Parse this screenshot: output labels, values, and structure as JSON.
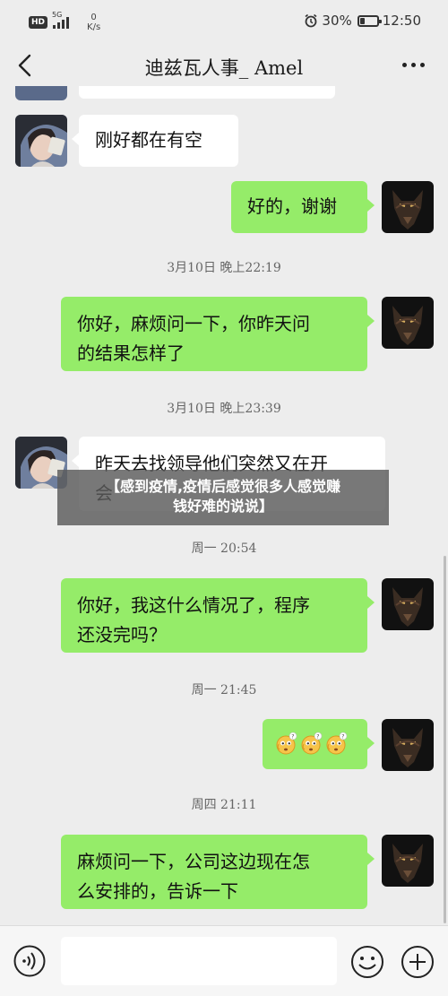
{
  "status_bar": {
    "hd_badge": "HD",
    "signal_label": "5G",
    "speed_value": "0",
    "speed_unit": "K/s",
    "battery": "30%",
    "battery_level": 0.3,
    "time": "12:50"
  },
  "header": {
    "title": "迪兹瓦人事_ Amel",
    "back_icon": "chevron-left-icon",
    "more_icon": "more-dots-icon"
  },
  "messages": [
    {
      "type": "in",
      "text": "刚好都在有空"
    },
    {
      "type": "out",
      "text": "好的，谢谢"
    },
    {
      "type": "time",
      "text": "3月10日  晚上22:19"
    },
    {
      "type": "out",
      "text_line1": "你好，麻烦问一下，你昨天问",
      "text_line2": "的结果怎样了"
    },
    {
      "type": "time",
      "text": "3月10日  晚上23:39"
    },
    {
      "type": "in",
      "text_line1": "昨天去找领导他们突然又在开",
      "text_line2": "会"
    },
    {
      "type": "time",
      "text": "周一  20:54"
    },
    {
      "type": "out",
      "text_line1": "你好，我这什么情况了，程序",
      "text_line2": "还没完吗？"
    },
    {
      "type": "time",
      "text": "周一  21:45"
    },
    {
      "type": "out",
      "emoji": "confused-face-icon",
      "emoji_count": 3
    },
    {
      "type": "time",
      "text": "周四  21:11"
    },
    {
      "type": "out",
      "text_line1": "麻烦问一下，公司这边现在怎",
      "text_line2": "么安排的，告诉一下"
    }
  ],
  "overlay": {
    "line1": "【感到疫情,疫情后感觉很多人感觉赚",
    "line2": "钱好难的说说】"
  },
  "input_bar": {
    "voice_icon": "voice-icon",
    "emoji_icon": "smile-icon",
    "plus_icon": "plus-circle-icon"
  },
  "colors": {
    "background": "#ededed",
    "incoming_bubble": "#ffffff",
    "outgoing_bubble": "#95ec69"
  }
}
